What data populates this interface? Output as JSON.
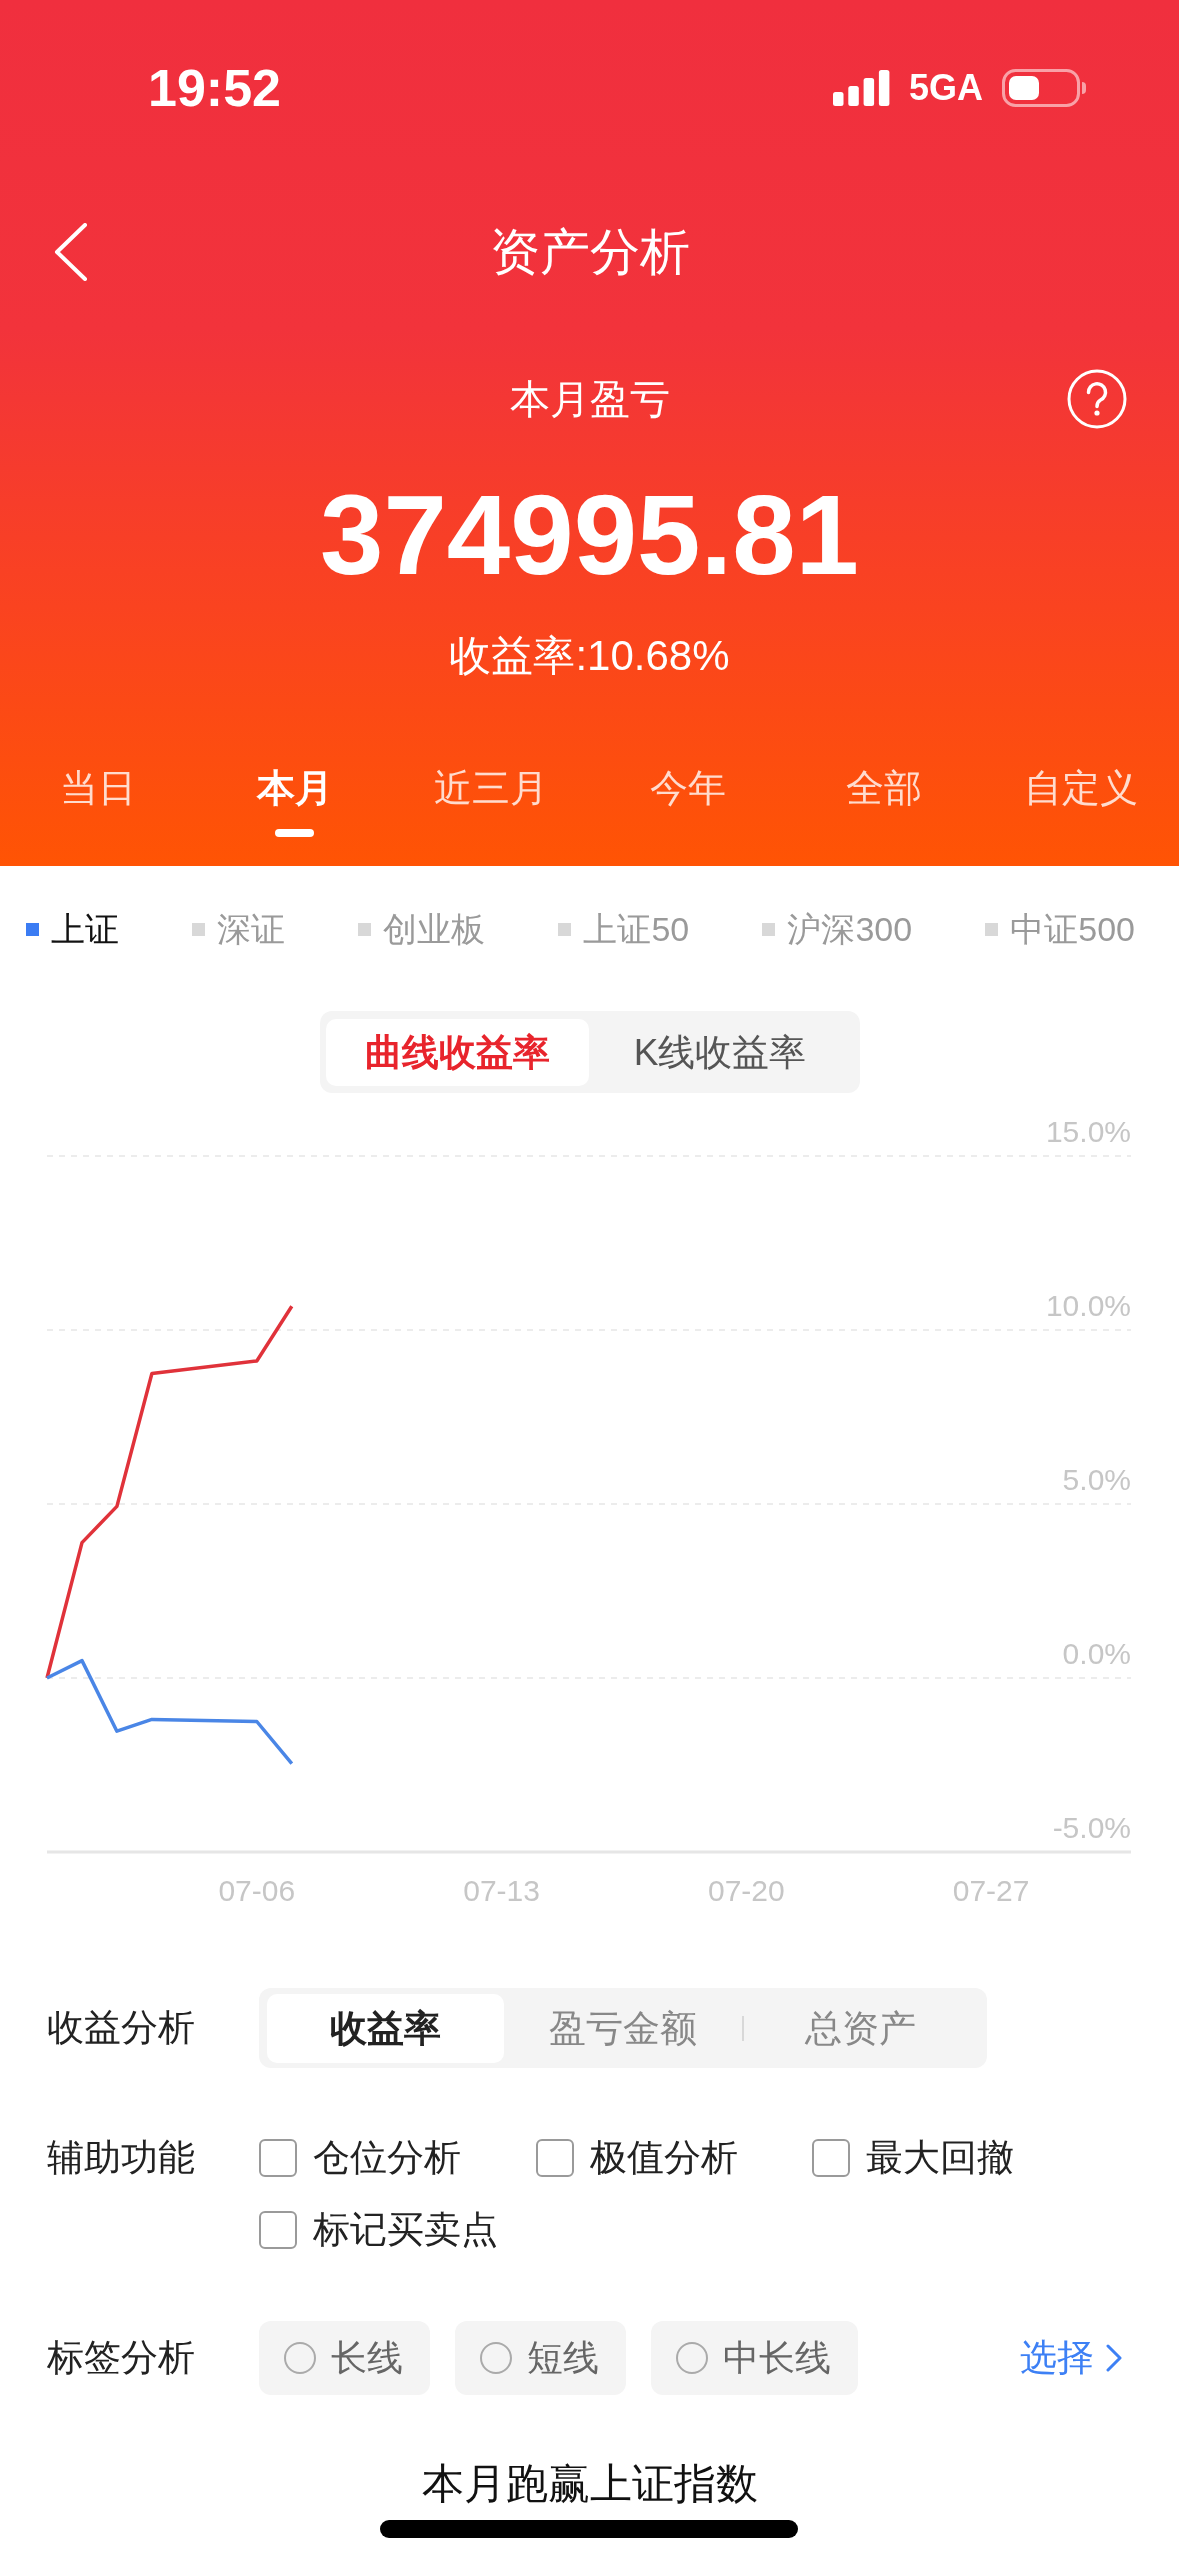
{
  "status_bar": {
    "time": "19:52",
    "network": "5GA"
  },
  "nav_bar": {
    "title": "资产分析"
  },
  "summary": {
    "label": "本月盈亏",
    "amount": "374995.81",
    "return_rate": "收益率:10.68%"
  },
  "period_tabs": [
    {
      "label": "当日",
      "selected": false
    },
    {
      "label": "本月",
      "selected": true
    },
    {
      "label": "近三月",
      "selected": false
    },
    {
      "label": "今年",
      "selected": false
    },
    {
      "label": "全部",
      "selected": false
    },
    {
      "label": "自定义",
      "selected": false
    }
  ],
  "index_legend": [
    {
      "label": "上证",
      "selected": true
    },
    {
      "label": "深证",
      "selected": false
    },
    {
      "label": "创业板",
      "selected": false
    },
    {
      "label": "上证50",
      "selected": false
    },
    {
      "label": "沪深300",
      "selected": false
    },
    {
      "label": "中证500",
      "selected": false
    }
  ],
  "chart_modes": [
    {
      "label": "曲线收益率",
      "selected": true
    },
    {
      "label": "K线收益率",
      "selected": false
    }
  ],
  "chart": {
    "chart_data": {
      "type": "line",
      "grid": true,
      "categories": [
        null,
        null,
        null,
        null,
        null,
        null,
        "07-06",
        null,
        null,
        null,
        null,
        null,
        null,
        "07-13",
        null,
        null,
        null,
        null,
        null,
        null,
        "07-20",
        null,
        null,
        null,
        null,
        null,
        null,
        "07-27",
        null,
        null,
        null,
        null
      ],
      "ylim": [
        -5,
        15
      ],
      "yticks": [
        {
          "value": 15,
          "label": "15.0%"
        },
        {
          "value": 10,
          "label": "10.0%"
        },
        {
          "value": 5,
          "label": "5.0%"
        },
        {
          "value": 0,
          "label": "0.0%"
        },
        {
          "value": -5,
          "label": "-5.0%"
        }
      ],
      "series": [
        {
          "color": "#e0323a",
          "values": [
            0,
            3.89,
            4.93,
            8.75,
            null,
            null,
            9.11,
            10.68,
            null,
            null,
            null,
            null,
            null,
            null,
            null,
            null,
            null,
            null,
            null,
            null,
            null,
            null,
            null,
            null,
            null,
            null,
            null,
            null,
            null,
            null,
            null,
            null
          ]
        },
        {
          "color": "#4a86e6",
          "values": [
            0,
            0.5,
            -1.53,
            -1.19,
            null,
            null,
            -1.25,
            -2.46,
            null,
            null,
            null,
            null,
            null,
            null,
            null,
            null,
            null,
            null,
            null,
            null,
            null,
            null,
            null,
            null,
            null,
            null,
            null,
            null,
            null,
            null,
            null,
            null
          ]
        }
      ]
    }
  },
  "analysis": {
    "profit_analysis": {
      "label": "收益分析",
      "options": [
        {
          "label": "收益率",
          "selected": true
        },
        {
          "label": "盈亏金额",
          "selected": false
        },
        {
          "label": "总资产",
          "selected": false
        }
      ]
    },
    "aux_functions": {
      "label": "辅助功能",
      "options": [
        {
          "label": "仓位分析",
          "checked": false
        },
        {
          "label": "极值分析",
          "checked": false
        },
        {
          "label": "最大回撤",
          "checked": false
        },
        {
          "label": "标记买卖点",
          "checked": false
        }
      ]
    },
    "tag_analysis": {
      "label": "标签分析",
      "options": [
        {
          "label": "长线",
          "selected": false
        },
        {
          "label": "短线",
          "selected": false
        },
        {
          "label": "中长线",
          "selected": false
        }
      ],
      "select_link": "选择"
    }
  },
  "section_heading": "本月跑赢上证指数"
}
